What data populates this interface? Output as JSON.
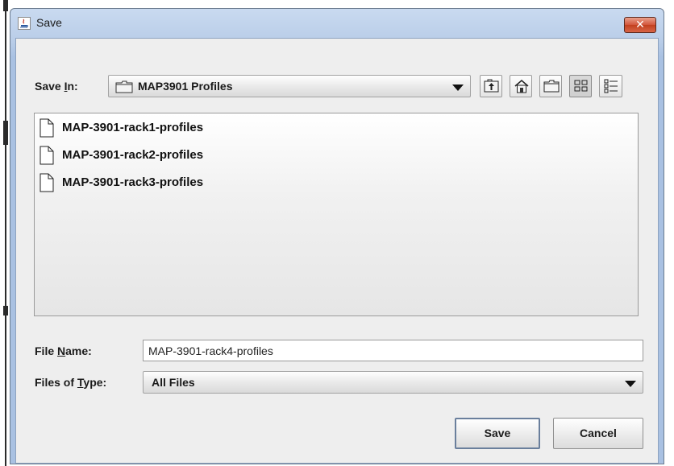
{
  "window": {
    "title": "Save",
    "close_glyph": "✕",
    "icon": "java-app-icon"
  },
  "toolbar": {
    "save_in_label_pre": "Save ",
    "save_in_label_mn": "I",
    "save_in_label_post": "n:",
    "location": "MAP3901 Profiles",
    "location_icon": "folder-icon",
    "buttons": [
      "up-one-level-icon",
      "home-icon",
      "new-folder-icon",
      "list-view-icon",
      "details-view-icon"
    ]
  },
  "files": [
    {
      "name": "MAP-3901-rack1-profiles",
      "icon": "file-icon"
    },
    {
      "name": "MAP-3901-rack2-profiles",
      "icon": "file-icon"
    },
    {
      "name": "MAP-3901-rack3-profiles",
      "icon": "file-icon"
    }
  ],
  "form": {
    "file_name_label_pre": "File ",
    "file_name_label_mn": "N",
    "file_name_label_post": "ame:",
    "file_name_value": "MAP-3901-rack4-profiles",
    "file_type_label_pre": "Files of ",
    "file_type_label_mn": "T",
    "file_type_label_post": "ype:",
    "file_type_value": "All Files"
  },
  "buttons": {
    "save": "Save",
    "cancel": "Cancel"
  }
}
